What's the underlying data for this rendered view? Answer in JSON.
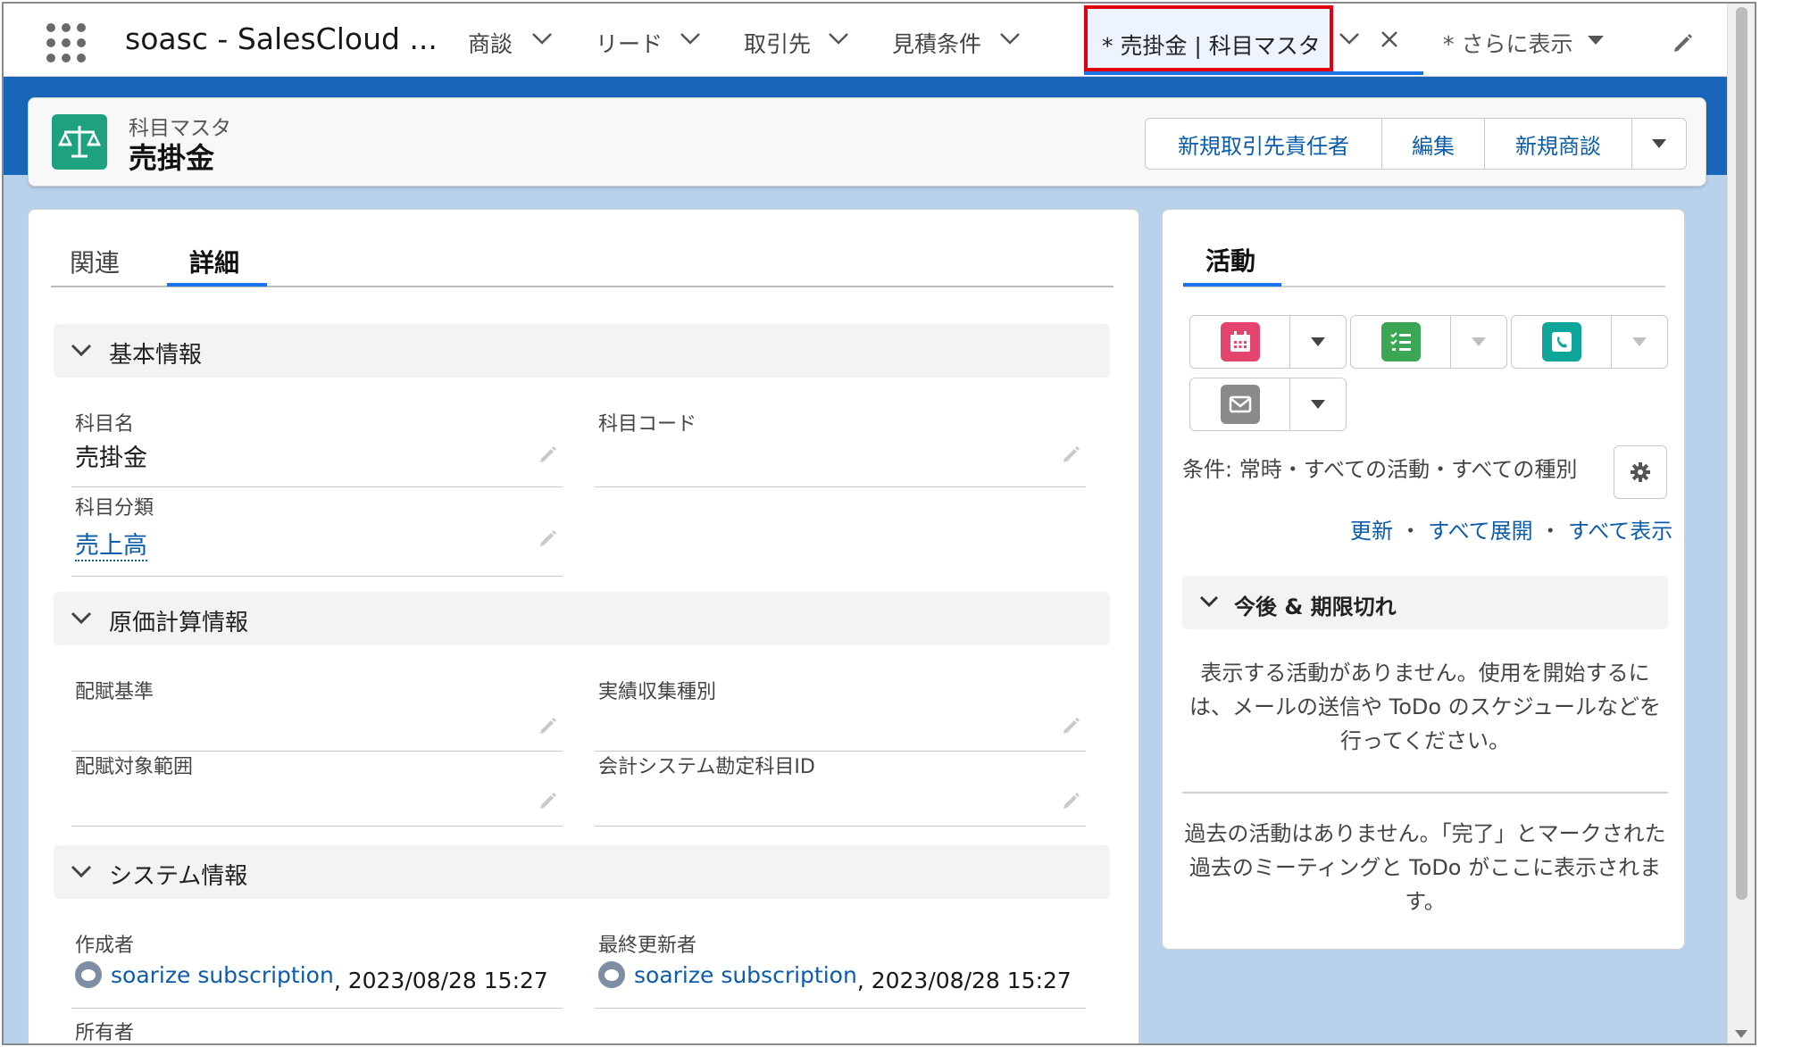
{
  "nav": {
    "app_name": "soasc - SalesCloud ...",
    "items": [
      "商談",
      "リード",
      "取引先",
      "見積条件"
    ],
    "active_tab": "* 売掛金 | 科目マスタ",
    "more": "* さらに表示"
  },
  "header": {
    "object_type": "科目マスタ",
    "record_name": "売掛金",
    "buttons": [
      "新規取引先責任者",
      "編集",
      "新規商談"
    ]
  },
  "tabs": {
    "related": "関連",
    "detail": "詳細"
  },
  "sections": {
    "basic": {
      "title": "基本情報",
      "fields": {
        "account_name": {
          "label": "科目名",
          "value": "売掛金"
        },
        "account_code": {
          "label": "科目コード",
          "value": ""
        },
        "category": {
          "label": "科目分類",
          "value": "売上高"
        }
      }
    },
    "cost": {
      "title": "原価計算情報",
      "fields": {
        "alloc_basis": {
          "label": "配賦基準",
          "value": ""
        },
        "actual_type": {
          "label": "実績収集種別",
          "value": ""
        },
        "alloc_range": {
          "label": "配賦対象範囲",
          "value": ""
        },
        "acct_sys_id": {
          "label": "会計システム勘定科目ID",
          "value": ""
        }
      }
    },
    "system": {
      "title": "システム情報",
      "created_by": {
        "label": "作成者",
        "user": "soarize subscription",
        "datetime": "2023/08/28 15:27"
      },
      "modified_by": {
        "label": "最終更新者",
        "user": "soarize subscription",
        "datetime": "2023/08/28 15:27"
      },
      "owner": {
        "label": "所有者"
      }
    }
  },
  "activity": {
    "title": "活動",
    "filter": "条件: 常時・すべての活動・すべての種別",
    "links": {
      "refresh": "更新",
      "expand_all": "すべて展開",
      "show_all": "すべて表示",
      "sep": "・"
    },
    "upcoming_title": "今後 & 期限切れ",
    "no_activity": "表示する活動がありません。使用を開始するには、メールの送信や ToDo のスケジュールなどを行ってください。",
    "past_activity": "過去の活動はありません。「完了」とマークされた過去のミーティングと ToDo がここに表示されます。",
    "icon_colors": {
      "event": "#e3456f",
      "task": "#3ba755",
      "call": "#0ea59a",
      "email": "#8a8a8a"
    }
  }
}
